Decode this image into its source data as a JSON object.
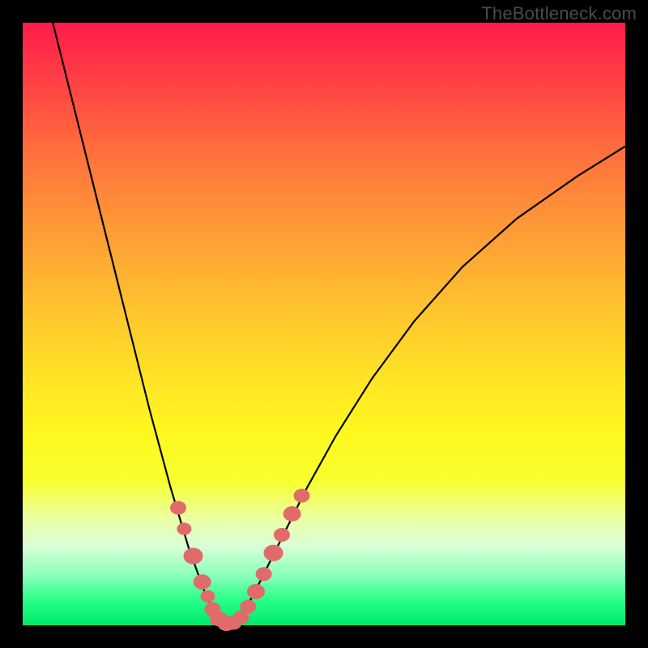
{
  "watermark": "TheBottleneck.com",
  "chart_data": {
    "type": "line",
    "title": "",
    "xlabel": "",
    "ylabel": "",
    "xlim": [
      0,
      1
    ],
    "ylim": [
      0,
      1
    ],
    "series": [
      {
        "name": "curve",
        "x": [
          0.05,
          0.09,
          0.13,
          0.17,
          0.21,
          0.245,
          0.275,
          0.3,
          0.315,
          0.325,
          0.34,
          0.355,
          0.37,
          0.385,
          0.4,
          0.43,
          0.47,
          0.52,
          0.58,
          0.65,
          0.73,
          0.82,
          0.92,
          1.0
        ],
        "y": [
          1.0,
          0.84,
          0.68,
          0.52,
          0.36,
          0.23,
          0.13,
          0.06,
          0.028,
          0.01,
          0.002,
          0.01,
          0.028,
          0.055,
          0.085,
          0.145,
          0.225,
          0.315,
          0.41,
          0.505,
          0.595,
          0.675,
          0.745,
          0.795
        ]
      }
    ],
    "markers": [
      {
        "x": 0.258,
        "y": 0.195,
        "r": 10
      },
      {
        "x": 0.268,
        "y": 0.16,
        "r": 9
      },
      {
        "x": 0.283,
        "y": 0.115,
        "r": 12
      },
      {
        "x": 0.298,
        "y": 0.072,
        "r": 11
      },
      {
        "x": 0.307,
        "y": 0.048,
        "r": 9
      },
      {
        "x": 0.315,
        "y": 0.027,
        "r": 10
      },
      {
        "x": 0.325,
        "y": 0.011,
        "r": 11
      },
      {
        "x": 0.338,
        "y": 0.003,
        "r": 11
      },
      {
        "x": 0.35,
        "y": 0.004,
        "r": 10
      },
      {
        "x": 0.362,
        "y": 0.013,
        "r": 10
      },
      {
        "x": 0.374,
        "y": 0.031,
        "r": 10
      },
      {
        "x": 0.387,
        "y": 0.056,
        "r": 11
      },
      {
        "x": 0.4,
        "y": 0.085,
        "r": 10
      },
      {
        "x": 0.416,
        "y": 0.12,
        "r": 12
      },
      {
        "x": 0.43,
        "y": 0.15,
        "r": 10
      },
      {
        "x": 0.447,
        "y": 0.185,
        "r": 11
      },
      {
        "x": 0.463,
        "y": 0.215,
        "r": 10
      }
    ],
    "marker_color": "#e16a6a",
    "curve_color": "#000000"
  }
}
